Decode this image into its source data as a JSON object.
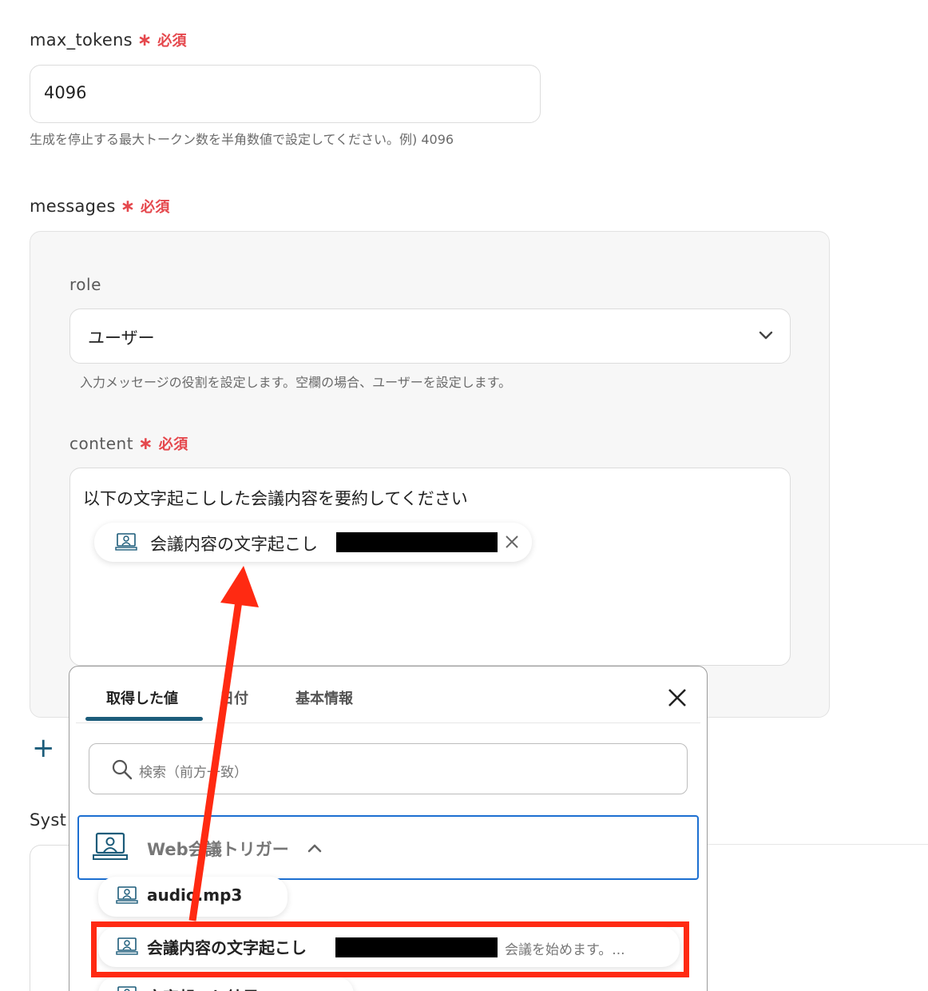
{
  "max_tokens": {
    "label": "max_tokens",
    "required_mark": "∗",
    "required_label": "必須",
    "value": "4096",
    "hint": "生成を停止する最大トークン数を半角数値で設定してください。例) 4096"
  },
  "messages": {
    "label": "messages",
    "required_mark": "∗",
    "required_label": "必須",
    "role": {
      "label": "role",
      "value": "ユーザー",
      "hint": "入力メッセージの役割を設定します。空欄の場合、ユーザーを設定します。"
    },
    "content": {
      "label": "content",
      "required_mark": "∗",
      "required_label": "必須",
      "text": "以下の文字起こしした会議内容を要約してください",
      "chip_label": "会議内容の文字起こし"
    },
    "add_symbol": "+"
  },
  "system_label": "Syst",
  "popup": {
    "tabs": [
      "取得した値",
      "日付",
      "基本情報"
    ],
    "search_placeholder": "検索（前方一致）",
    "trigger_label": "Web会議トリガー",
    "items": [
      {
        "label": "audio.mp3"
      },
      {
        "label": "会議内容の文字起こし",
        "preview": "会議を始めます。..."
      },
      {
        "label": "文字起こし結果URL"
      }
    ]
  },
  "colors": {
    "required": "#e5484d",
    "accent": "#1c5c7a",
    "selection_border": "#1c6fd1",
    "annotation": "#ff2a12"
  }
}
